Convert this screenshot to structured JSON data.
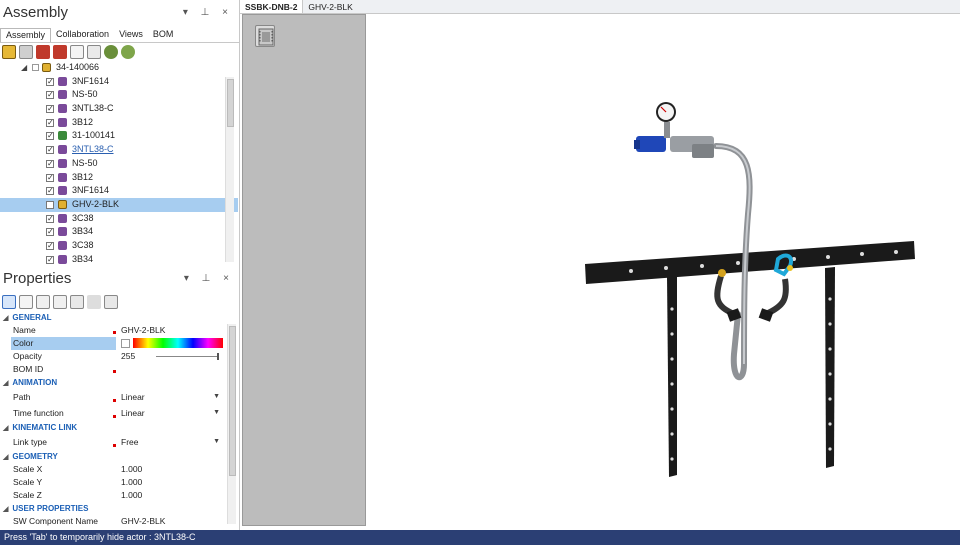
{
  "assembly_panel": {
    "title": "Assembly",
    "controls": "▾ ⊥ ×",
    "tabs": [
      {
        "label": "Assembly",
        "active": true
      },
      {
        "label": "Collaboration",
        "active": false
      },
      {
        "label": "Views",
        "active": false
      },
      {
        "label": "BOM",
        "active": false
      }
    ],
    "tree": {
      "root": "34-140066",
      "items": [
        {
          "label": "3NF1614",
          "checked": true,
          "icon": "part-icon"
        },
        {
          "label": "NS-50",
          "checked": true,
          "icon": "part-icon"
        },
        {
          "label": "3NTL38-C",
          "checked": true,
          "icon": "part-icon"
        },
        {
          "label": "3B12",
          "checked": true,
          "icon": "part-icon"
        },
        {
          "label": "31-100141",
          "checked": true,
          "icon": "part-icon-green"
        },
        {
          "label": "3NTL38-C",
          "checked": true,
          "icon": "part-icon",
          "link": true
        },
        {
          "label": "NS-50",
          "checked": true,
          "icon": "part-icon"
        },
        {
          "label": "3B12",
          "checked": true,
          "icon": "part-icon"
        },
        {
          "label": "3NF1614",
          "checked": true,
          "icon": "part-icon"
        },
        {
          "label": "GHV-2-BLK",
          "checked": false,
          "icon": "assembly-icon",
          "selected": true
        },
        {
          "label": "3C38",
          "checked": true,
          "icon": "part-icon"
        },
        {
          "label": "3B34",
          "checked": true,
          "icon": "part-icon"
        },
        {
          "label": "3C38",
          "checked": true,
          "icon": "part-icon"
        },
        {
          "label": "3B34",
          "checked": true,
          "icon": "part-icon"
        }
      ]
    }
  },
  "properties_panel": {
    "title": "Properties",
    "controls": "▾ ⊥ ×",
    "sections": {
      "general": "GENERAL",
      "animation": "ANIMATION",
      "kinematic": "KINEMATIC LINK",
      "geometry": "GEOMETRY",
      "user": "USER PROPERTIES"
    },
    "rows": {
      "name": {
        "label": "Name",
        "value": "GHV-2-BLK"
      },
      "color": {
        "label": "Color"
      },
      "opacity": {
        "label": "Opacity",
        "value": "255"
      },
      "bom_id": {
        "label": "BOM ID",
        "value": ""
      },
      "path": {
        "label": "Path",
        "value": "Linear"
      },
      "time_function": {
        "label": "Time function",
        "value": "Linear"
      },
      "link_type": {
        "label": "Link type",
        "value": "Free"
      },
      "scale_x": {
        "label": "Scale X",
        "value": "1.000"
      },
      "scale_y": {
        "label": "Scale Y",
        "value": "1.000"
      },
      "scale_z": {
        "label": "Scale Z",
        "value": "1.000"
      },
      "sw_component": {
        "label": "SW Component Name",
        "value": "GHV-2-BLK"
      }
    }
  },
  "document_tabs": [
    {
      "label": "SSBK-DNB-2",
      "active": true
    },
    {
      "label": "GHV-2-BLK",
      "active": false
    }
  ],
  "status_bar": {
    "text": "Press 'Tab' to temporarily hide actor : 3NTL38-C"
  },
  "colors": {
    "status_bg": "#2b3f74",
    "selection": "#a7cdf0",
    "section_heading": "#1b5fb5",
    "bracket": "#1a1a1a",
    "valve_blue": "#1f47b8",
    "connector_cyan": "#1fa8d8"
  }
}
